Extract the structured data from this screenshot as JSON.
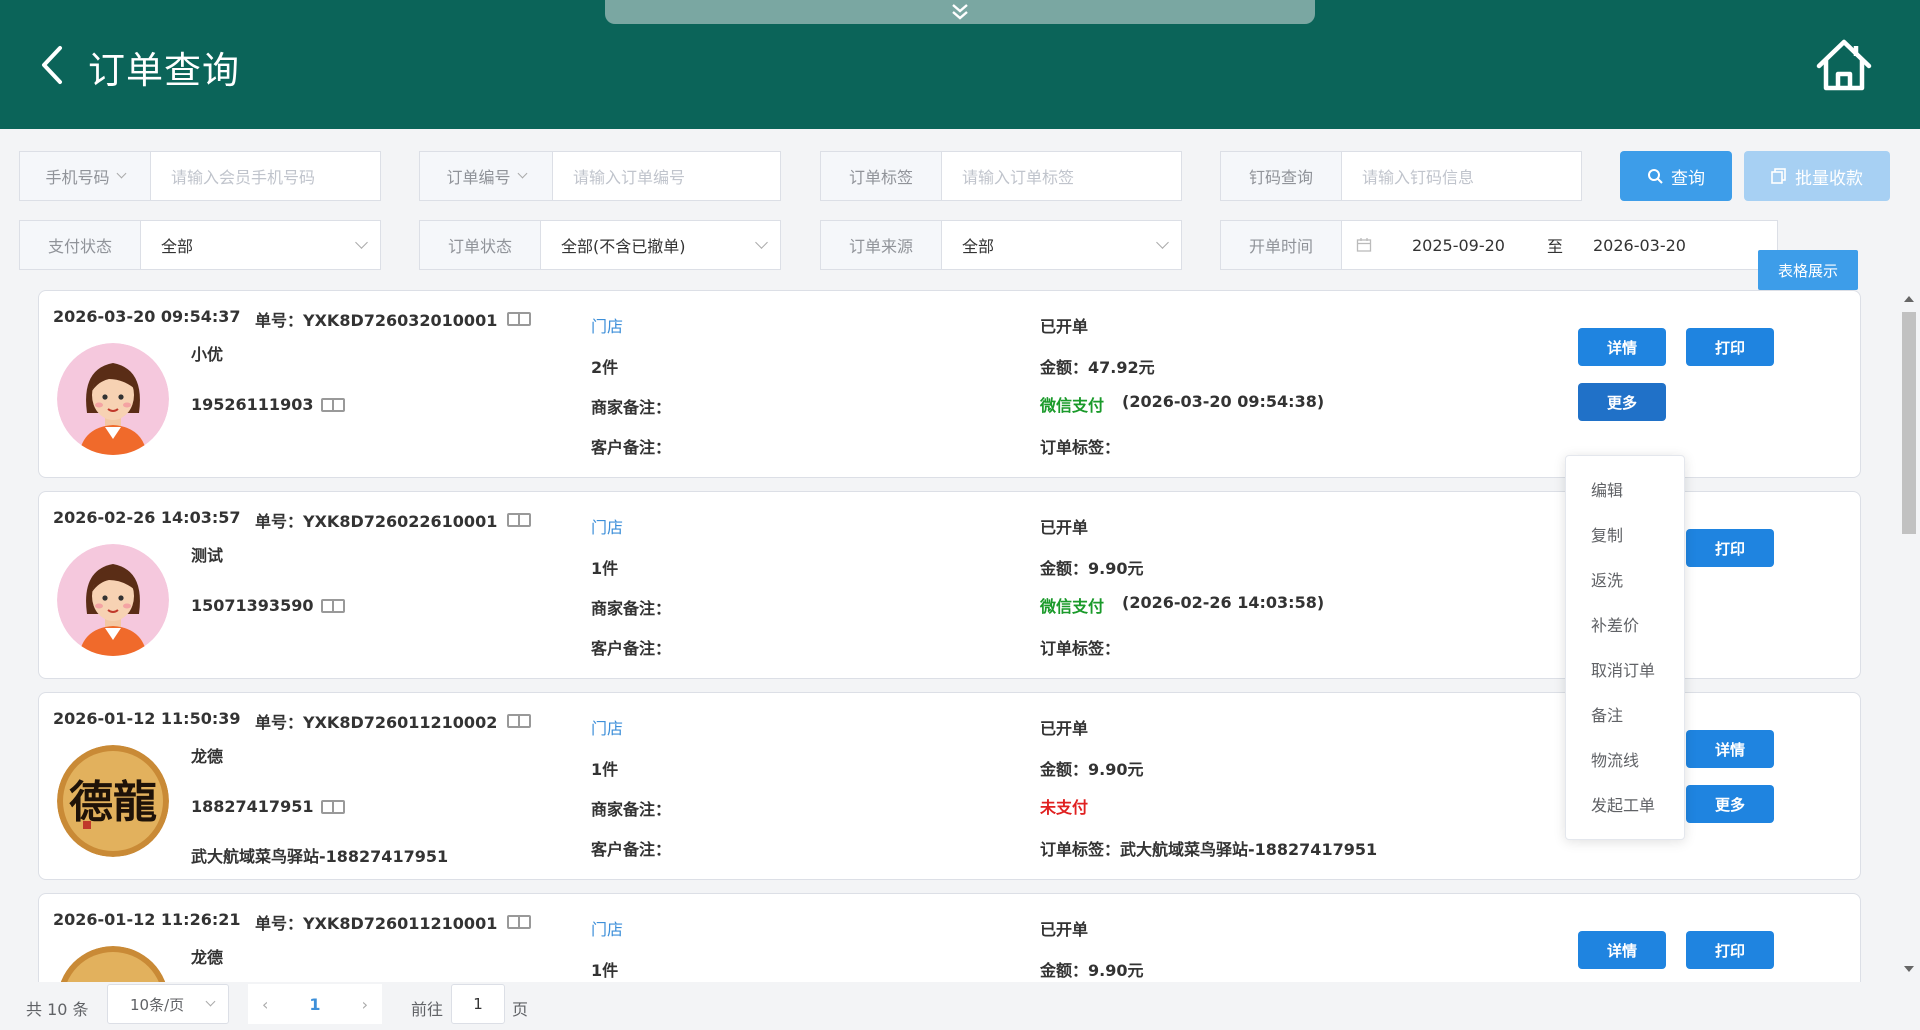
{
  "header": {
    "title": "订单查询"
  },
  "filters": {
    "phone": {
      "label": "手机号码",
      "placeholder": "请输入会员手机号码"
    },
    "order_no": {
      "label": "订单编号",
      "placeholder": "请输入订单编号"
    },
    "order_tag": {
      "label": "订单标签",
      "placeholder": "请输入订单标签"
    },
    "nail_code": {
      "label": "钉码查询",
      "placeholder": "请输入钉码信息"
    },
    "pay_status": {
      "label": "支付状态",
      "value": "全部"
    },
    "order_status": {
      "label": "订单状态",
      "value": "全部(不含已撤单)"
    },
    "order_source": {
      "label": "订单来源",
      "value": "全部"
    },
    "open_time": {
      "label": "开单时间",
      "start": "2025-09-20",
      "separator": "至",
      "end": "2026-03-20"
    }
  },
  "toolbar": {
    "query_label": "查询",
    "batch_label": "批量收款",
    "table_view_label": "表格展示"
  },
  "orders": [
    {
      "datetime": "2026-03-20 09:54:37",
      "order_no": "单号：YXK8D726032010001",
      "name": "小优",
      "phone": "19526111903",
      "address": "",
      "store": "门店",
      "qty": "2件",
      "merchant_note": "商家备注：",
      "customer_note": "客户备注：",
      "status": "已开单",
      "amount": "金额：47.92元",
      "pay_method": "微信支付",
      "pay_time": "(2026-03-20 09:54:38)",
      "tag": "订单标签：",
      "avatar": "woman-avatar"
    },
    {
      "datetime": "2026-02-26 14:03:57",
      "order_no": "单号：YXK8D726022610001",
      "name": "测试",
      "phone": "15071393590",
      "address": "",
      "store": "门店",
      "qty": "1件",
      "merchant_note": "商家备注：",
      "customer_note": "客户备注：",
      "status": "已开单",
      "amount": "金额：9.90元",
      "pay_method": "微信支付",
      "pay_time": "(2026-02-26 14:03:58)",
      "tag": "订单标签：",
      "avatar": "woman-avatar"
    },
    {
      "datetime": "2026-01-12 11:50:39",
      "order_no": "单号：YXK8D726011210002",
      "name": "龙德",
      "phone": "18827417951",
      "address": "武大航域菜鸟驿站-18827417951",
      "store": "门店",
      "qty": "1件",
      "merchant_note": "商家备注：",
      "customer_note": "客户备注：",
      "status": "已开单",
      "amount": "金额：9.90元",
      "pay_method": "未支付",
      "pay_time": "",
      "tag": "订单标签：武大航域菜鸟驿站-18827417951",
      "avatar": "calligraphy-avatar",
      "avatar_text": "德龍"
    },
    {
      "datetime": "2026-01-12 11:26:21",
      "order_no": "单号：YXK8D726011210001",
      "name": "龙德",
      "phone": "",
      "address": "",
      "store": "门店",
      "qty": "1件",
      "merchant_note": "",
      "customer_note": "",
      "status": "已开单",
      "amount": "金额：9.90元",
      "pay_method": "",
      "pay_time": "",
      "tag": "",
      "avatar": "calligraphy-avatar"
    }
  ],
  "actions": {
    "detail": "详情",
    "print": "打印",
    "more": "更多"
  },
  "more_menu": [
    "编辑",
    "复制",
    "返洗",
    "补差价",
    "取消订单",
    "备注",
    "物流线",
    "发起工单"
  ],
  "pagination": {
    "total": "共 10 条",
    "page_size": "10条/页",
    "current_page": "1",
    "goto_label": "前往",
    "goto_value": "1",
    "page_suffix": "页"
  },
  "colors": {
    "header_bg": "#0b6459",
    "primary": "#3d9de9",
    "action_button": "#1f84e0",
    "paid_green": "#1a9a2a",
    "unpaid_red": "#e02020"
  }
}
